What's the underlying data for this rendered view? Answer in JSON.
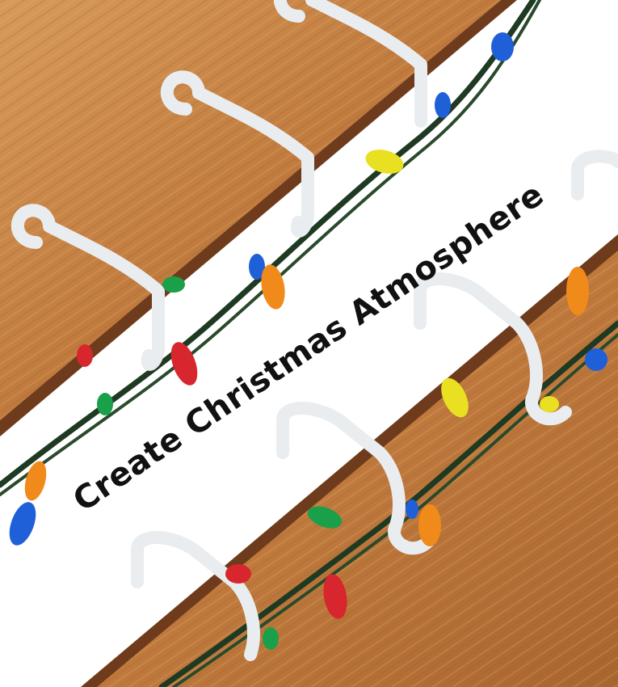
{
  "caption": {
    "text": "Create Christmas Atmosphere"
  },
  "colors": {
    "wood_light": "#cf8f4f",
    "wood_mid": "#b8743a",
    "wood_dark": "#7a4420",
    "wire": "#1f3a22",
    "clip": "#eef1f3",
    "bulb_red": "#d7262e",
    "bulb_orange": "#f08a1a",
    "bulb_yellow": "#e8e020",
    "bulb_blue": "#1f5fd8",
    "bulb_green": "#1aa04a",
    "text": "#111111"
  },
  "icons": [
    "wood-shelf-upper",
    "wood-shelf-lower",
    "light-string",
    "plastic-clip",
    "bulb"
  ]
}
